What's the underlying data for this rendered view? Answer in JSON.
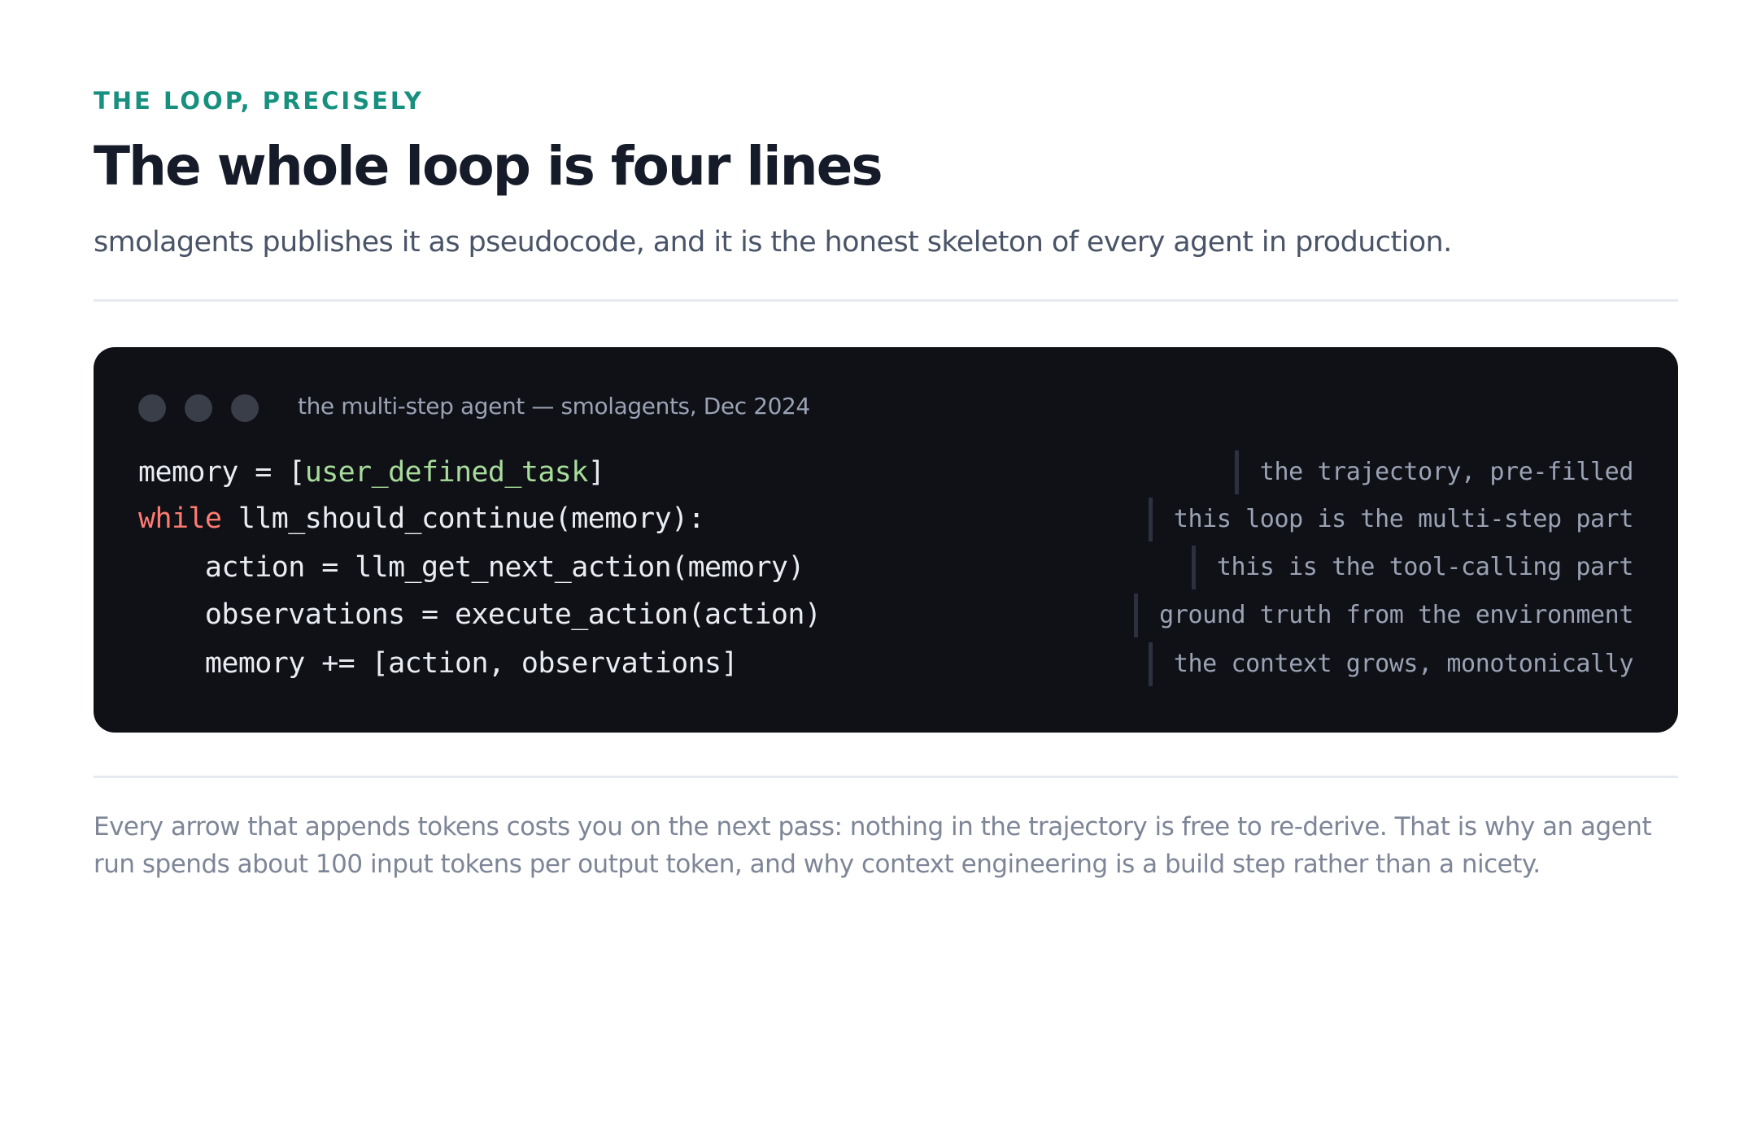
{
  "header": {
    "eyebrow": "THE LOOP, PRECISELY",
    "title": "The whole loop is four lines",
    "subtitle": "smolagents publishes it as pseudocode, and it is the honest skeleton of every agent in production."
  },
  "code_window": {
    "title": "the multi-step agent — smolagents, Dec 2024",
    "lines": [
      {
        "indent": "",
        "keyword": "",
        "before": "memory = [",
        "string": "user_defined_task",
        "after": "]",
        "note": "the trajectory, pre-filled"
      },
      {
        "indent": "",
        "keyword": "while",
        "before": " llm_should_continue(memory):",
        "string": "",
        "after": "",
        "note": "this loop is the multi-step part"
      },
      {
        "indent": "    ",
        "keyword": "",
        "before": "action = llm_get_next_action(memory)",
        "string": "",
        "after": "",
        "note": "this is the tool-calling part"
      },
      {
        "indent": "    ",
        "keyword": "",
        "before": "observations = execute_action(action)",
        "string": "",
        "after": "",
        "note": "ground truth from the environment"
      },
      {
        "indent": "    ",
        "keyword": "",
        "before": "memory += [action, observations]",
        "string": "",
        "after": "",
        "note": "the context grows, monotonically"
      }
    ]
  },
  "footer": {
    "text": "Every arrow that appends tokens costs you on the next pass: nothing in the trajectory is free to re-derive. That is why an agent run spends about 100 input tokens per output token, and why context engineering is a build step rather than a nicety."
  },
  "colors": {
    "accent": "#17907f",
    "title": "#161b29",
    "code_bg": "#0f1117",
    "string": "#a8dc9a",
    "keyword": "#ff7b72"
  }
}
